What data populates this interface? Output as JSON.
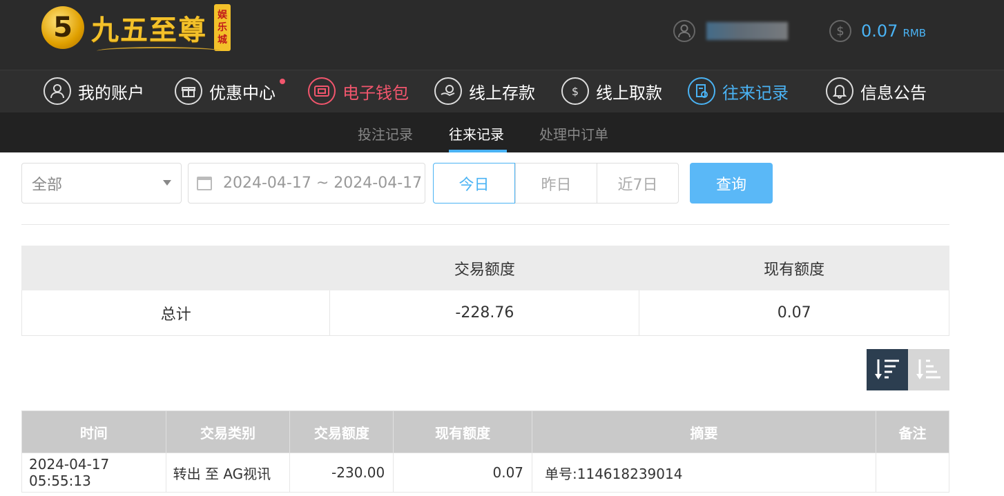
{
  "brand": {
    "logo_text": "九五至尊",
    "seal_text": "娱乐城"
  },
  "account": {
    "balance": "0.07",
    "currency": "RMB"
  },
  "main_nav": [
    {
      "label": "我的账户",
      "icon": "user-icon"
    },
    {
      "label": "优惠中心",
      "icon": "gift-icon"
    },
    {
      "label": "电子钱包",
      "icon": "wallet-icon"
    },
    {
      "label": "线上存款",
      "icon": "deposit-icon"
    },
    {
      "label": "线上取款",
      "icon": "withdraw-icon"
    },
    {
      "label": "往来记录",
      "icon": "records-icon"
    },
    {
      "label": "信息公告",
      "icon": "bell-icon"
    }
  ],
  "sub_nav": [
    {
      "label": "投注记录"
    },
    {
      "label": "往来记录"
    },
    {
      "label": "处理中订单"
    }
  ],
  "filter": {
    "type_selected": "全部",
    "date_range": "2024-04-17 ~ 2024-04-17",
    "today": "今日",
    "yesterday": "昨日",
    "last7": "近7日",
    "query": "查询"
  },
  "summary": {
    "headers": [
      "",
      "交易额度",
      "现有额度"
    ],
    "row": {
      "label": "总计",
      "amount": "-228.76",
      "balance": "0.07"
    }
  },
  "detail": {
    "headers": [
      "时间",
      "交易类别",
      "交易额度",
      "现有额度",
      "摘要",
      "备注"
    ],
    "rows": [
      {
        "time": "2024-04-17 05:55:13",
        "type": "转出 至 AG视讯",
        "amount": "-230.00",
        "balance": "0.07",
        "summary": "单号:114618239014",
        "note": ""
      }
    ]
  },
  "colors": {
    "accent": "#4ab3f4",
    "wallet": "#f2566d",
    "topbar": "#2b2b2b"
  }
}
